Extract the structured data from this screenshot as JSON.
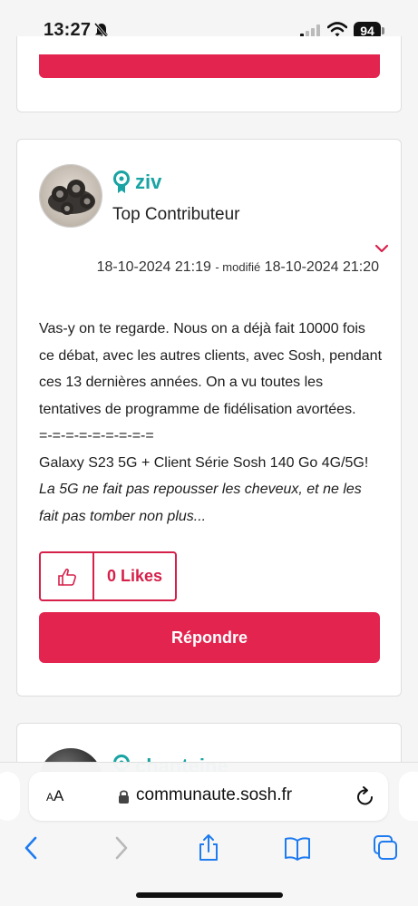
{
  "status_bar": {
    "time": "13:27",
    "battery": "94"
  },
  "post": {
    "username": "ziv",
    "rank": "Top Contributeur",
    "date_posted": "18-10-2024 21:19",
    "modified_label": "- modifié",
    "date_modified": "18-10-2024 21:20",
    "body": [
      "Vas-y on te regarde. Nous on a déjà fait 10000 fois ce débat, avec les autres clients, avec Sosh, pendant ces 13 dernières années. On a vu toutes les tentatives de programme de fidélisation avortées."
    ],
    "signature_divider": "=-=-=-=-=-=-=-=-=",
    "signature_line": "Galaxy S23 5G + Client Série Sosh 140 Go 4G/5G!",
    "signature_italic": "La 5G ne fait pas repousser les cheveux, et ne les fait pas tomber non plus...",
    "likes": "0 Likes",
    "reply_label": "Répondre"
  },
  "next_post": {
    "username": "chanteine"
  },
  "browser": {
    "text_size_label_small": "A",
    "text_size_label_big": "A",
    "url": "communaute.sosh.fr"
  },
  "colors": {
    "accent": "#e2244f",
    "teal": "#19a3a3"
  },
  "icons": [
    "bell-slash-icon",
    "signal-icon",
    "wifi-icon",
    "chevron-down-icon",
    "thumbs-up-icon",
    "lock-icon",
    "reload-icon",
    "back-icon",
    "forward-icon",
    "share-icon",
    "bookmarks-icon",
    "tabs-icon",
    "rank-icon"
  ]
}
